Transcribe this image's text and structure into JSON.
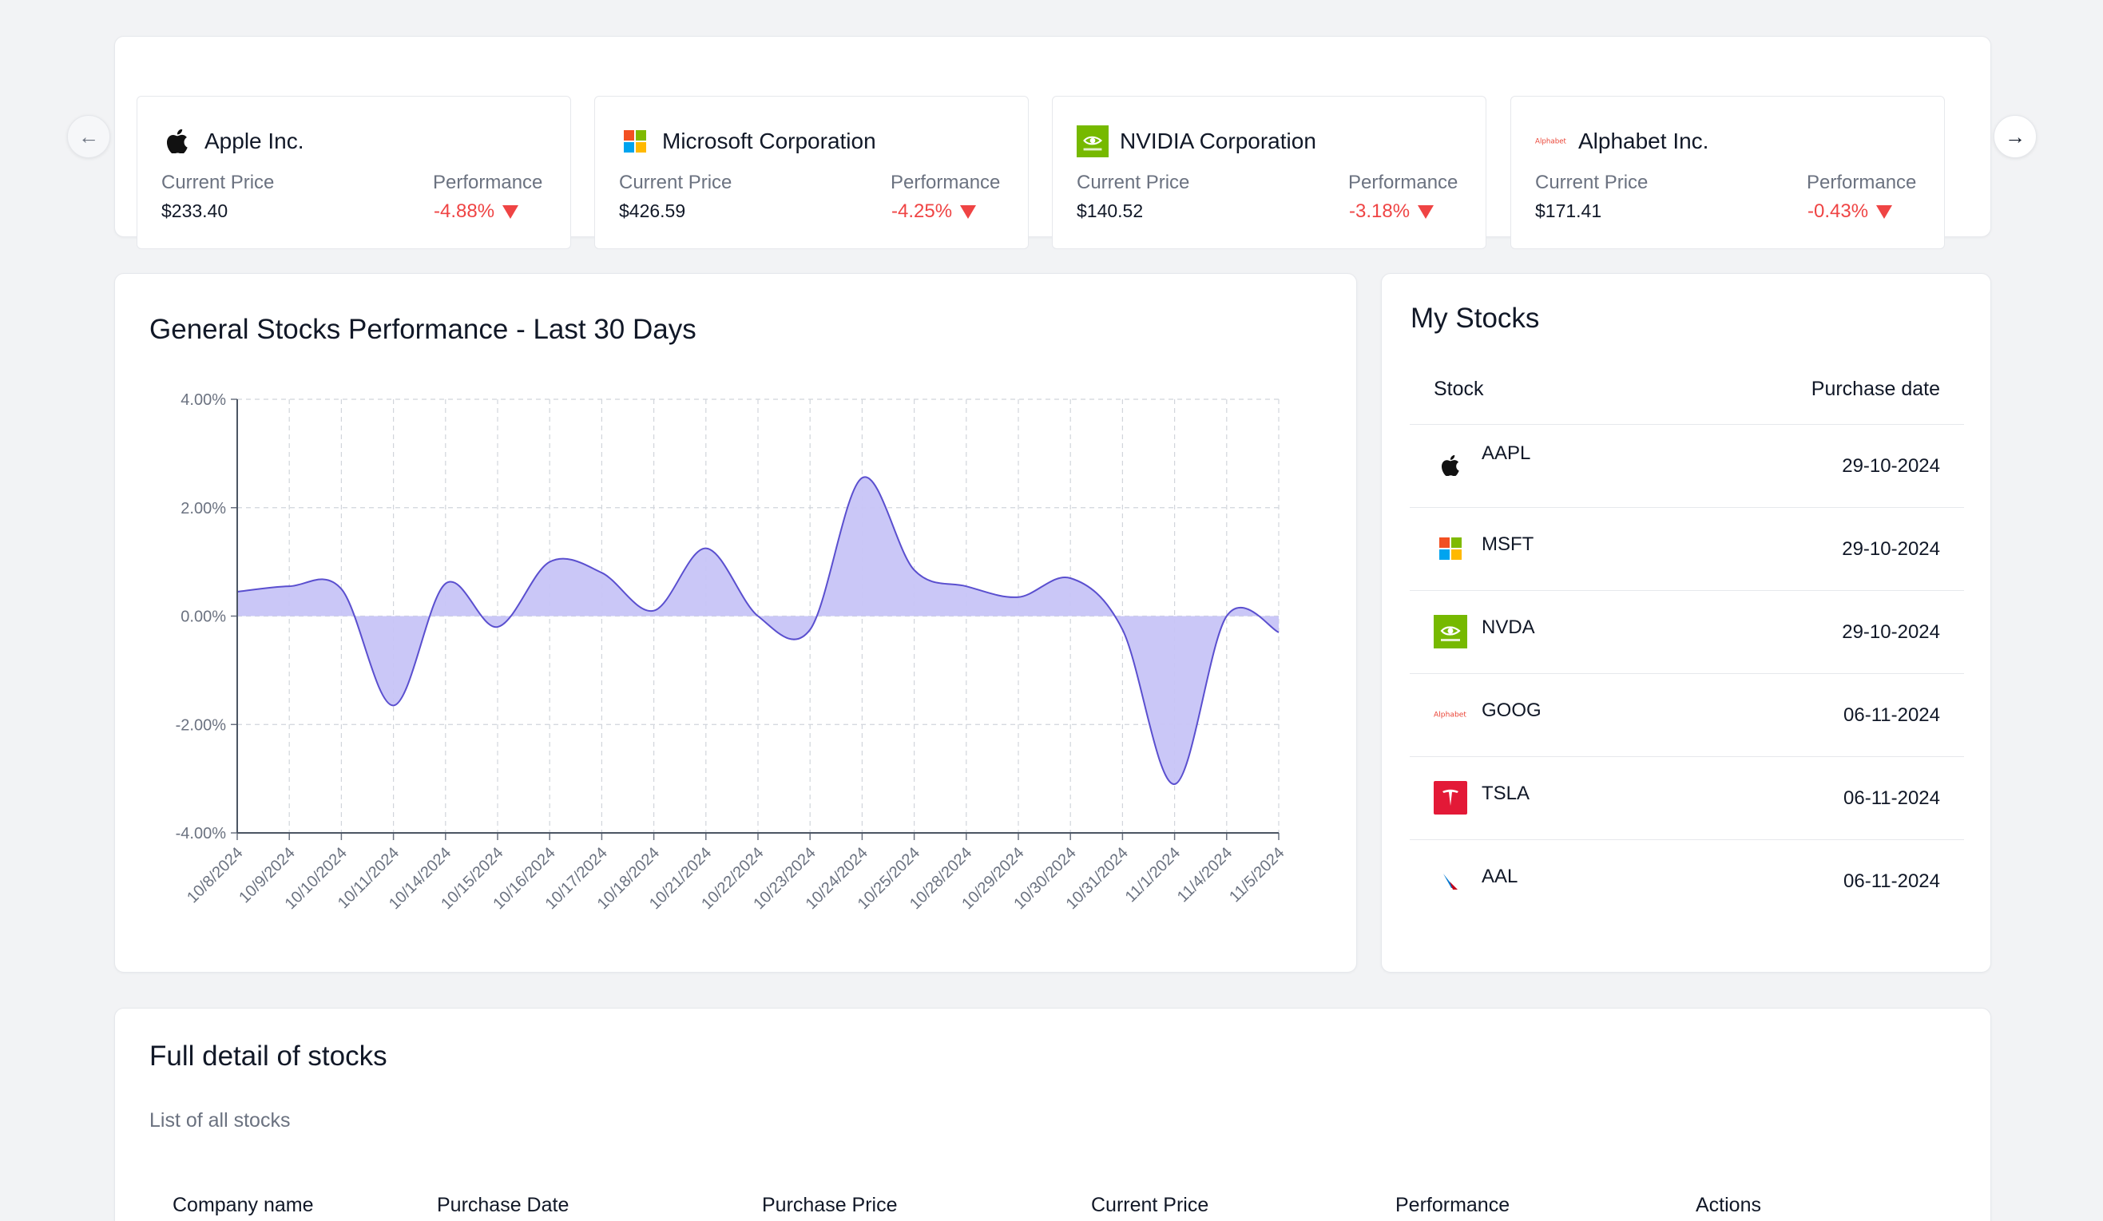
{
  "ticker": {
    "cards": [
      {
        "name": "Apple Inc.",
        "price_label": "Current Price",
        "price": "$233.40",
        "perf_label": "Performance",
        "perf": "-4.88%",
        "logo": "apple-logo"
      },
      {
        "name": "Microsoft Corporation",
        "price_label": "Current Price",
        "price": "$426.59",
        "perf_label": "Performance",
        "perf": "-4.25%",
        "logo": "microsoft-logo"
      },
      {
        "name": "NVIDIA Corporation",
        "price_label": "Current Price",
        "price": "$140.52",
        "perf_label": "Performance",
        "perf": "-3.18%",
        "logo": "nvidia-logo"
      },
      {
        "name": "Alphabet Inc.",
        "price_label": "Current Price",
        "price": "$171.41",
        "perf_label": "Performance",
        "perf": "-0.43%",
        "logo": "alphabet-logo"
      }
    ],
    "prev_icon": "arrow-left-icon",
    "next_icon": "arrow-right-icon"
  },
  "colors": {
    "negative": "#ef4444",
    "area_fill": "#c7c4f7",
    "area_stroke": "#5a4fcf"
  },
  "chart_panel": {
    "title": "General Stocks Performance - Last 30 Days"
  },
  "chart_data": {
    "type": "area",
    "title": "General Stocks Performance - Last 30 Days",
    "categories": [
      "10/8/2024",
      "10/9/2024",
      "10/10/2024",
      "10/11/2024",
      "10/14/2024",
      "10/15/2024",
      "10/16/2024",
      "10/17/2024",
      "10/18/2024",
      "10/21/2024",
      "10/22/2024",
      "10/23/2024",
      "10/24/2024",
      "10/25/2024",
      "10/28/2024",
      "10/29/2024",
      "10/30/2024",
      "10/31/2024",
      "11/1/2024",
      "11/4/2024",
      "11/5/2024"
    ],
    "values": [
      0.45,
      0.55,
      0.5,
      -1.65,
      0.6,
      -0.2,
      1.0,
      0.8,
      0.1,
      1.25,
      0.0,
      -0.25,
      2.55,
      0.85,
      0.55,
      0.35,
      0.7,
      -0.25,
      -3.1,
      0.0,
      -0.3
    ],
    "ylim": [
      -4,
      4
    ],
    "yticks": [
      "4.00%",
      "2.00%",
      "0.00%",
      "-2.00%",
      "-4.00%"
    ],
    "grid": true
  },
  "my_stocks": {
    "title": "My Stocks",
    "col_stock": "Stock",
    "col_date": "Purchase date",
    "rows": [
      {
        "ticker": "AAPL",
        "date": "29-10-2024",
        "logo": "apple-logo"
      },
      {
        "ticker": "MSFT",
        "date": "29-10-2024",
        "logo": "microsoft-logo"
      },
      {
        "ticker": "NVDA",
        "date": "29-10-2024",
        "logo": "nvidia-logo"
      },
      {
        "ticker": "GOOG",
        "date": "06-11-2024",
        "logo": "alphabet-logo"
      },
      {
        "ticker": "TSLA",
        "date": "06-11-2024",
        "logo": "tesla-logo"
      },
      {
        "ticker": "AAL",
        "date": "06-11-2024",
        "logo": "american-airlines-logo"
      }
    ]
  },
  "detail": {
    "title": "Full detail of stocks",
    "subtitle": "List of all stocks",
    "columns": [
      "Company name",
      "Purchase Date",
      "Purchase Price",
      "Current Price",
      "Performance",
      "Actions"
    ]
  }
}
